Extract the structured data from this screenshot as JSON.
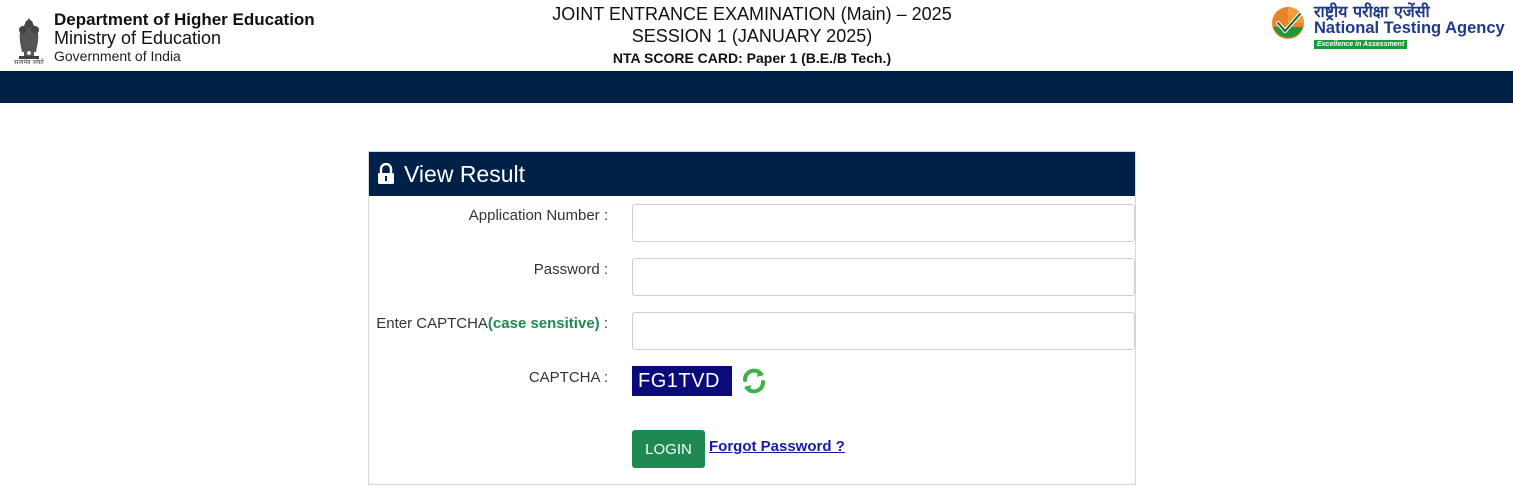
{
  "header": {
    "emblem_caption": "सत्यमेव जयते",
    "dept_line1": "Department of Higher Education",
    "dept_line2": "Ministry of Education",
    "dept_line3": "Government of India",
    "exam_line1": "JOINT ENTRANCE EXAMINATION (Main) – 2025",
    "exam_line2": "SESSION 1 (JANUARY 2025)",
    "exam_line3": "NTA SCORE CARD: Paper 1 (B.E./B Tech.)",
    "nta_hindi": "राष्ट्रीय परीक्षा एजेंसी",
    "nta_english": "National Testing Agency",
    "nta_tagline": "Excellence in Assessment"
  },
  "panel": {
    "title": "View Result",
    "fields": {
      "application_number_label": "Application Number :",
      "application_number_value": "",
      "password_label": "Password :",
      "password_value": "",
      "captcha_input_label_prefix": "Enter CAPTCHA",
      "captcha_input_label_hint": "(case sensitive)",
      "captcha_input_label_suffix": " :",
      "captcha_input_value": "",
      "captcha_label": "CAPTCHA :",
      "captcha_text": "FG1TVD"
    },
    "login_label": "LOGIN",
    "forgot_label": "Forgot Password ?"
  },
  "colors": {
    "navy": "#002147",
    "green": "#1e8a52",
    "captcha_bg": "#0a0a7a",
    "link": "#1a1aa8"
  }
}
